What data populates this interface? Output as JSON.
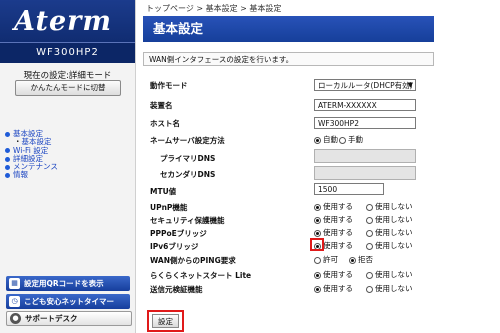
{
  "sidebar": {
    "logo": "Aterm",
    "model": "WF300HP2",
    "mode_text": "現在の設定:詳細モード",
    "easy_mode_button": "かんたんモードに切替",
    "nav": {
      "basic": "基本設定",
      "basic_sub": "基本設定",
      "wifi": "Wi-Fi 設定",
      "detail": "詳細設定",
      "maintenance": "メンテナンス",
      "info": "情報"
    },
    "qr_button": "設定用QRコードを表示",
    "kids_timer_button": "こども安心ネットタイマー",
    "support_button": "サポートデスク"
  },
  "breadcrumb": "トップページ > 基本設定 > 基本設定",
  "page_title": "基本設定",
  "description": "WAN側インタフェースの設定を行います。",
  "form": {
    "operation_mode": {
      "label": "動作モード",
      "value": "ローカルルータ(DHCP有効)"
    },
    "device_name": {
      "label": "装置名",
      "value": "ATERM-XXXXXX"
    },
    "host_name": {
      "label": "ホスト名",
      "value": "WF300HP2"
    },
    "nameserver": {
      "label": "ネームサーバ設定方法",
      "opt1": "自動",
      "opt2": "手動",
      "selected": 1
    },
    "primary_dns": {
      "label": "プライマリDNS",
      "value": ""
    },
    "secondary_dns": {
      "label": "セカンダリDNS",
      "value": ""
    },
    "mtu": {
      "label": "MTU値",
      "value": "1500"
    },
    "upnp": {
      "label": "UPnP機能",
      "opt1": "使用する",
      "opt2": "使用しない",
      "selected": 1
    },
    "security": {
      "label": "セキュリティ保護機能",
      "opt1": "使用する",
      "opt2": "使用しない",
      "selected": 1
    },
    "pppoe": {
      "label": "PPPoEブリッジ",
      "opt1": "使用する",
      "opt2": "使用しない",
      "selected": 1
    },
    "ipv6": {
      "label": "IPv6ブリッジ",
      "opt1": "使用する",
      "opt2": "使用しない",
      "selected": 1
    },
    "wan_ping": {
      "label": "WAN側からのPING要求",
      "opt1": "許可",
      "opt2": "拒否",
      "selected": 2
    },
    "raku_start": {
      "label": "らくらくネットスタート Lite",
      "opt1": "使用する",
      "opt2": "使用しない",
      "selected": 1
    },
    "send_source": {
      "label": "送信元検証機能",
      "opt1": "使用する",
      "opt2": "使用しない",
      "selected": 1
    }
  },
  "apply_button": "設定",
  "colors": {
    "header_blue": "#1c47a5",
    "highlight_red": "#e01a1a",
    "nav_link": "#1a44c2"
  }
}
